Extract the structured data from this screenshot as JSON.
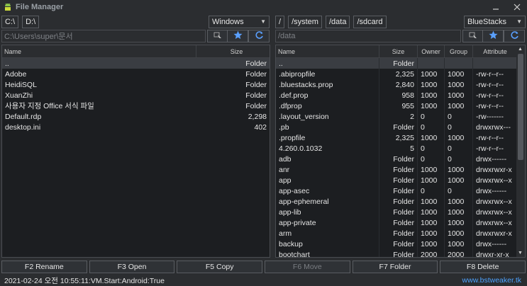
{
  "app": {
    "title": "File Manager"
  },
  "left": {
    "drives": [
      "C:\\",
      "D:\\"
    ],
    "os_combo": "Windows",
    "path": "C:\\Users\\super\\문서",
    "columns": [
      "Name",
      "Size"
    ],
    "rows": [
      {
        "name": "..",
        "size": "Folder"
      },
      {
        "name": "Adobe",
        "size": "Folder"
      },
      {
        "name": "HeidiSQL",
        "size": "Folder"
      },
      {
        "name": "XuanZhi",
        "size": "Folder"
      },
      {
        "name": "사용자 지정 Office 서식 파일",
        "size": "Folder"
      },
      {
        "name": "Default.rdp",
        "size": "2,298"
      },
      {
        "name": "desktop.ini",
        "size": "402"
      }
    ]
  },
  "right": {
    "paths": [
      "/",
      "/system",
      "/data",
      "/sdcard"
    ],
    "device_combo": "BlueStacks",
    "path": "/data",
    "columns": [
      "Name",
      "Size",
      "Owner",
      "Group",
      "Attribute"
    ],
    "rows": [
      {
        "name": "..",
        "size": "Folder",
        "owner": "",
        "group": "",
        "attr": ""
      },
      {
        "name": ".abipropfile",
        "size": "2,325",
        "owner": "1000",
        "group": "1000",
        "attr": "-rw-r--r--"
      },
      {
        "name": ".bluestacks.prop",
        "size": "2,840",
        "owner": "1000",
        "group": "1000",
        "attr": "-rw-r--r--"
      },
      {
        "name": ".def.prop",
        "size": "958",
        "owner": "1000",
        "group": "1000",
        "attr": "-rw-r--r--"
      },
      {
        "name": ".dfprop",
        "size": "955",
        "owner": "1000",
        "group": "1000",
        "attr": "-rw-r--r--"
      },
      {
        "name": ".layout_version",
        "size": "2",
        "owner": "0",
        "group": "0",
        "attr": "-rw-------"
      },
      {
        "name": ".pb",
        "size": "Folder",
        "owner": "0",
        "group": "0",
        "attr": "drwxrwx---"
      },
      {
        "name": ".propfile",
        "size": "2,325",
        "owner": "1000",
        "group": "1000",
        "attr": "-rw-r--r--"
      },
      {
        "name": "4.260.0.1032",
        "size": "5",
        "owner": "0",
        "group": "0",
        "attr": "-rw-r--r--"
      },
      {
        "name": "adb",
        "size": "Folder",
        "owner": "0",
        "group": "0",
        "attr": "drwx------"
      },
      {
        "name": "anr",
        "size": "Folder",
        "owner": "1000",
        "group": "1000",
        "attr": "drwxrwxr-x"
      },
      {
        "name": "app",
        "size": "Folder",
        "owner": "1000",
        "group": "1000",
        "attr": "drwxrwx--x"
      },
      {
        "name": "app-asec",
        "size": "Folder",
        "owner": "0",
        "group": "0",
        "attr": "drwx------"
      },
      {
        "name": "app-ephemeral",
        "size": "Folder",
        "owner": "1000",
        "group": "1000",
        "attr": "drwxrwx--x"
      },
      {
        "name": "app-lib",
        "size": "Folder",
        "owner": "1000",
        "group": "1000",
        "attr": "drwxrwx--x"
      },
      {
        "name": "app-private",
        "size": "Folder",
        "owner": "1000",
        "group": "1000",
        "attr": "drwxrwx--x"
      },
      {
        "name": "arm",
        "size": "Folder",
        "owner": "1000",
        "group": "1000",
        "attr": "drwxrwxr-x"
      },
      {
        "name": "backup",
        "size": "Folder",
        "owner": "1000",
        "group": "1000",
        "attr": "drwx------"
      },
      {
        "name": "bootchart",
        "size": "Folder",
        "owner": "2000",
        "group": "2000",
        "attr": "drwxr-xr-x"
      }
    ]
  },
  "fkeys": [
    {
      "label": "F2 Rename",
      "enabled": true
    },
    {
      "label": "F3 Open",
      "enabled": true
    },
    {
      "label": "F5 Copy",
      "enabled": true
    },
    {
      "label": "F6 Move",
      "enabled": false
    },
    {
      "label": "F7 Folder",
      "enabled": true
    },
    {
      "label": "F8 Delete",
      "enabled": true
    }
  ],
  "status": {
    "text": "2021-02-24 오전 10:55:11:VM.Start:Android:True",
    "link": "www.bstweaker.tk"
  },
  "icons": {
    "app": "android-icon",
    "minimize": "minimize-icon",
    "close": "close-icon",
    "bookmark": "star-icon",
    "refresh": "refresh-icon",
    "goto": "cursor-icon"
  },
  "colors": {
    "accent": "#4da3ff",
    "background": "#2b2d30",
    "list_bg": "#1c1e21"
  }
}
